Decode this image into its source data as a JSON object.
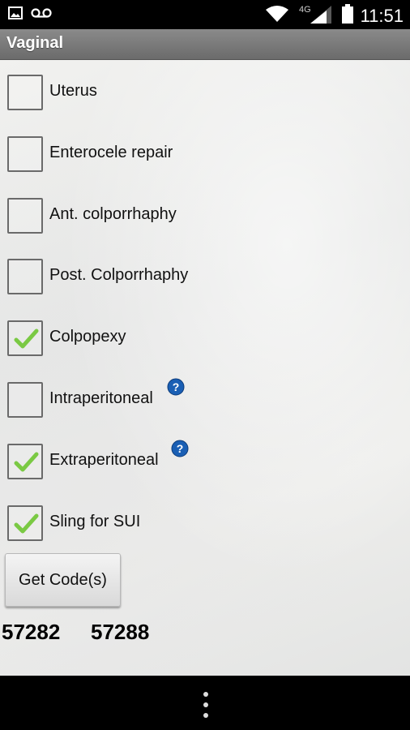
{
  "status_bar": {
    "time": "11:51",
    "network": "4G",
    "icons": [
      "image-icon",
      "voicemail-icon",
      "wifi-icon",
      "signal-icon",
      "battery-icon"
    ]
  },
  "title": "Vaginal",
  "options": [
    {
      "label": "Uterus",
      "checked": false,
      "help": false
    },
    {
      "label": "Enterocele repair",
      "checked": false,
      "help": false
    },
    {
      "label": "Ant. colporrhaphy",
      "checked": false,
      "help": false
    },
    {
      "label": "Post. Colporrhaphy",
      "checked": false,
      "help": false
    },
    {
      "label": "Colpopexy",
      "checked": true,
      "help": false
    },
    {
      "label": "Intraperitoneal",
      "checked": false,
      "help": true
    },
    {
      "label": "Extraperitoneal",
      "checked": true,
      "help": true
    },
    {
      "label": "Sling for SUI",
      "checked": true,
      "help": true
    }
  ],
  "button": {
    "label": "Get Code(s)"
  },
  "codes": [
    "57282",
    "57288"
  ],
  "colors": {
    "check": "#7ac943",
    "help": "#1a5fb4",
    "title_bar": "#7a7a7a"
  }
}
